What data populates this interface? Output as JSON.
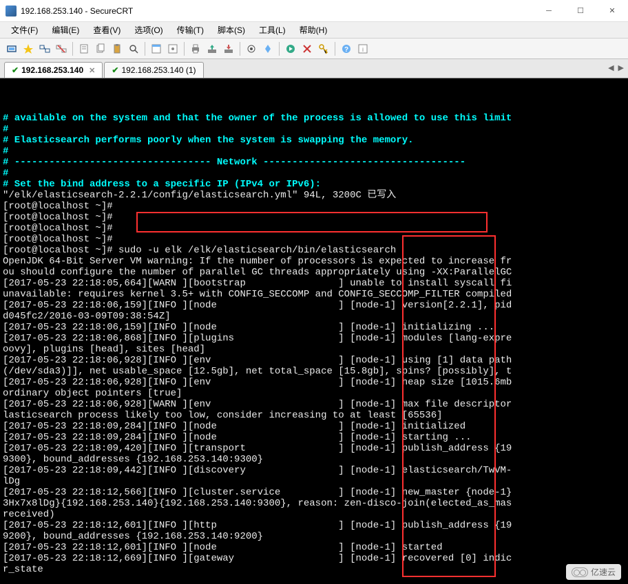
{
  "window": {
    "title": "192.168.253.140 - SecureCRT"
  },
  "menu": {
    "file": "文件(F)",
    "edit": "编辑(E)",
    "view": "查看(V)",
    "options": "选项(O)",
    "transfer": "传输(T)",
    "script": "脚本(S)",
    "tools": "工具(L)",
    "help": "帮助(H)"
  },
  "tabs": {
    "active": "192.168.253.140",
    "inactive": "192.168.253.140 (1)",
    "close": "✕",
    "nav_left": "◀",
    "nav_right": "▶"
  },
  "highlight_command": "sudo -u elk /elk/elasticsearch/bin/elasticsearch",
  "terminal": {
    "lines": [
      {
        "cls": "cyan",
        "text": "# available on the system and that the owner of the process is allowed to use this limit"
      },
      {
        "cls": "cyan",
        "text": "#"
      },
      {
        "cls": "cyan",
        "text": "# Elasticsearch performs poorly when the system is swapping the memory."
      },
      {
        "cls": "cyan",
        "text": "#"
      },
      {
        "cls": "cyan",
        "text": "# ---------------------------------- Network -----------------------------------"
      },
      {
        "cls": "cyan",
        "text": "#"
      },
      {
        "cls": "cyan",
        "text": "# Set the bind address to a specific IP (IPv4 or IPv6):"
      },
      {
        "cls": "white",
        "text": "\"/elk/elasticsearch-2.2.1/config/elasticsearch.yml\" 94L, 3200C 已写入"
      },
      {
        "cls": "white",
        "text": "[root@localhost ~]#"
      },
      {
        "cls": "white",
        "text": "[root@localhost ~]#"
      },
      {
        "cls": "white",
        "text": "[root@localhost ~]#"
      },
      {
        "cls": "white",
        "text": "[root@localhost ~]#"
      },
      {
        "cls": "white",
        "text": "[root@localhost ~]# sudo -u elk /elk/elasticsearch/bin/elasticsearch"
      },
      {
        "cls": "white",
        "text": "OpenJDK 64-Bit Server VM warning: If the number of processors is expected to increase fr"
      },
      {
        "cls": "white",
        "text": "ou should configure the number of parallel GC threads appropriately using -XX:ParallelGC"
      },
      {
        "cls": "white",
        "text": "[2017-05-23 22:18:05,664][WARN ][bootstrap                ] unable to install syscall fi"
      },
      {
        "cls": "white",
        "text": "unavailable: requires kernel 3.5+ with CONFIG_SECCOMP and CONFIG_SECCOMP_FILTER compiled"
      },
      {
        "cls": "white",
        "text": "[2017-05-23 22:18:06,159][INFO ][node                     ] [node-1] version[2.2.1], pid"
      },
      {
        "cls": "white",
        "text": "d045fc2/2016-03-09T09:38:54Z]"
      },
      {
        "cls": "white",
        "text": "[2017-05-23 22:18:06,159][INFO ][node                     ] [node-1] initializing ..."
      },
      {
        "cls": "white",
        "text": "[2017-05-23 22:18:06,868][INFO ][plugins                  ] [node-1] modules [lang-expre"
      },
      {
        "cls": "white",
        "text": "oovy], plugins [head], sites [head]"
      },
      {
        "cls": "white",
        "text": "[2017-05-23 22:18:06,928][INFO ][env                      ] [node-1] using [1] data path"
      },
      {
        "cls": "white",
        "text": "(/dev/sda3)]], net usable_space [12.5gb], net total_space [15.8gb], spins? [possibly], t"
      },
      {
        "cls": "white",
        "text": "[2017-05-23 22:18:06,928][INFO ][env                      ] [node-1] heap size [1015.6mb"
      },
      {
        "cls": "white",
        "text": "ordinary object pointers [true]"
      },
      {
        "cls": "white",
        "text": "[2017-05-23 22:18:06,928][WARN ][env                      ] [node-1] max file descriptor"
      },
      {
        "cls": "white",
        "text": "lasticsearch process likely too low, consider increasing to at least [65536]"
      },
      {
        "cls": "white",
        "text": "[2017-05-23 22:18:09,284][INFO ][node                     ] [node-1] initialized"
      },
      {
        "cls": "white",
        "text": "[2017-05-23 22:18:09,284][INFO ][node                     ] [node-1] starting ..."
      },
      {
        "cls": "white",
        "text": "[2017-05-23 22:18:09,420][INFO ][transport                ] [node-1] publish_address {19"
      },
      {
        "cls": "white",
        "text": "9300}, bound_addresses {192.168.253.140:9300}"
      },
      {
        "cls": "white",
        "text": "[2017-05-23 22:18:09,442][INFO ][discovery                ] [node-1] elasticsearch/TwVM-"
      },
      {
        "cls": "white",
        "text": "lDg"
      },
      {
        "cls": "white",
        "text": "[2017-05-23 22:18:12,566][INFO ][cluster.service          ] [node-1] new_master {node-1}"
      },
      {
        "cls": "white",
        "text": "3Hx7x8lDg}{192.168.253.140}{192.168.253.140:9300}, reason: zen-disco-join(elected_as_mas"
      },
      {
        "cls": "white",
        "text": "received)"
      },
      {
        "cls": "white",
        "text": "[2017-05-23 22:18:12,601][INFO ][http                     ] [node-1] publish_address {19"
      },
      {
        "cls": "white",
        "text": "9200}, bound_addresses {192.168.253.140:9200}"
      },
      {
        "cls": "white",
        "text": "[2017-05-23 22:18:12,601][INFO ][node                     ] [node-1] started"
      },
      {
        "cls": "white",
        "text": "[2017-05-23 22:18:12,669][INFO ][gateway                  ] [node-1] recovered [0] indic"
      },
      {
        "cls": "white",
        "text": "r_state"
      }
    ]
  },
  "watermark": "亿速云"
}
